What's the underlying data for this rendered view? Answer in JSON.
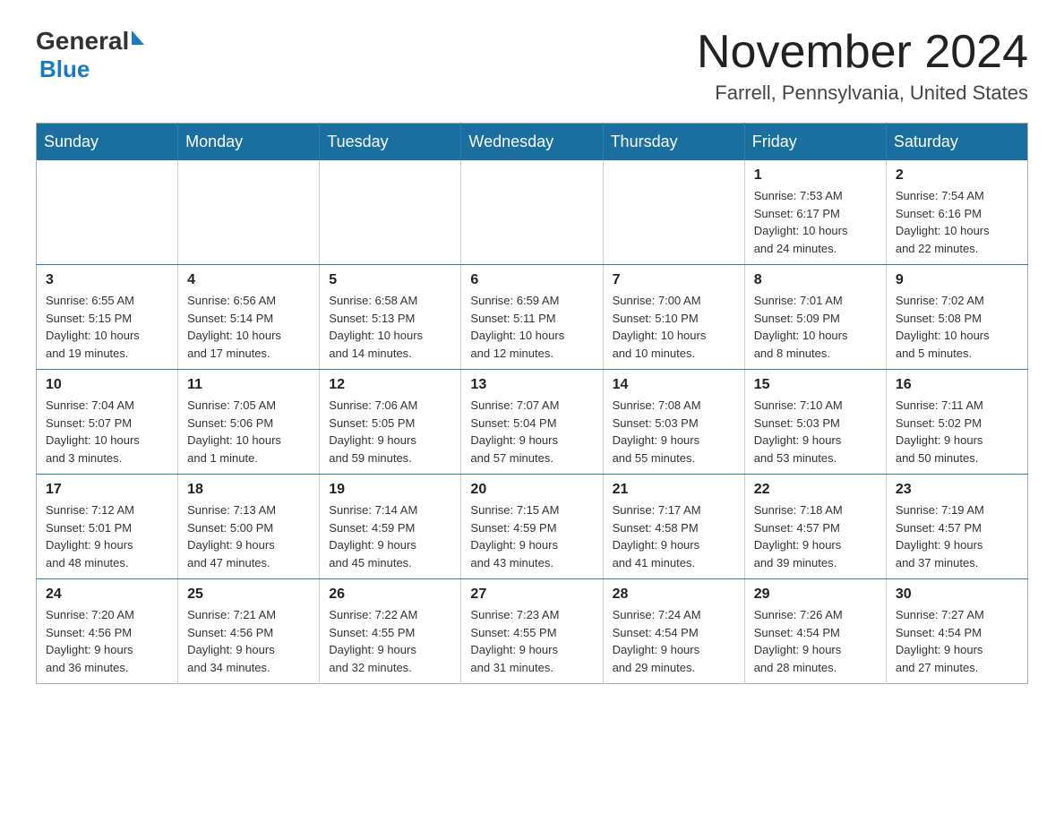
{
  "header": {
    "logo": {
      "general": "General",
      "blue": "Blue"
    },
    "title": "November 2024",
    "location": "Farrell, Pennsylvania, United States"
  },
  "weekdays": [
    "Sunday",
    "Monday",
    "Tuesday",
    "Wednesday",
    "Thursday",
    "Friday",
    "Saturday"
  ],
  "weeks": [
    [
      {
        "day": "",
        "info": ""
      },
      {
        "day": "",
        "info": ""
      },
      {
        "day": "",
        "info": ""
      },
      {
        "day": "",
        "info": ""
      },
      {
        "day": "",
        "info": ""
      },
      {
        "day": "1",
        "info": "Sunrise: 7:53 AM\nSunset: 6:17 PM\nDaylight: 10 hours\nand 24 minutes."
      },
      {
        "day": "2",
        "info": "Sunrise: 7:54 AM\nSunset: 6:16 PM\nDaylight: 10 hours\nand 22 minutes."
      }
    ],
    [
      {
        "day": "3",
        "info": "Sunrise: 6:55 AM\nSunset: 5:15 PM\nDaylight: 10 hours\nand 19 minutes."
      },
      {
        "day": "4",
        "info": "Sunrise: 6:56 AM\nSunset: 5:14 PM\nDaylight: 10 hours\nand 17 minutes."
      },
      {
        "day": "5",
        "info": "Sunrise: 6:58 AM\nSunset: 5:13 PM\nDaylight: 10 hours\nand 14 minutes."
      },
      {
        "day": "6",
        "info": "Sunrise: 6:59 AM\nSunset: 5:11 PM\nDaylight: 10 hours\nand 12 minutes."
      },
      {
        "day": "7",
        "info": "Sunrise: 7:00 AM\nSunset: 5:10 PM\nDaylight: 10 hours\nand 10 minutes."
      },
      {
        "day": "8",
        "info": "Sunrise: 7:01 AM\nSunset: 5:09 PM\nDaylight: 10 hours\nand 8 minutes."
      },
      {
        "day": "9",
        "info": "Sunrise: 7:02 AM\nSunset: 5:08 PM\nDaylight: 10 hours\nand 5 minutes."
      }
    ],
    [
      {
        "day": "10",
        "info": "Sunrise: 7:04 AM\nSunset: 5:07 PM\nDaylight: 10 hours\nand 3 minutes."
      },
      {
        "day": "11",
        "info": "Sunrise: 7:05 AM\nSunset: 5:06 PM\nDaylight: 10 hours\nand 1 minute."
      },
      {
        "day": "12",
        "info": "Sunrise: 7:06 AM\nSunset: 5:05 PM\nDaylight: 9 hours\nand 59 minutes."
      },
      {
        "day": "13",
        "info": "Sunrise: 7:07 AM\nSunset: 5:04 PM\nDaylight: 9 hours\nand 57 minutes."
      },
      {
        "day": "14",
        "info": "Sunrise: 7:08 AM\nSunset: 5:03 PM\nDaylight: 9 hours\nand 55 minutes."
      },
      {
        "day": "15",
        "info": "Sunrise: 7:10 AM\nSunset: 5:03 PM\nDaylight: 9 hours\nand 53 minutes."
      },
      {
        "day": "16",
        "info": "Sunrise: 7:11 AM\nSunset: 5:02 PM\nDaylight: 9 hours\nand 50 minutes."
      }
    ],
    [
      {
        "day": "17",
        "info": "Sunrise: 7:12 AM\nSunset: 5:01 PM\nDaylight: 9 hours\nand 48 minutes."
      },
      {
        "day": "18",
        "info": "Sunrise: 7:13 AM\nSunset: 5:00 PM\nDaylight: 9 hours\nand 47 minutes."
      },
      {
        "day": "19",
        "info": "Sunrise: 7:14 AM\nSunset: 4:59 PM\nDaylight: 9 hours\nand 45 minutes."
      },
      {
        "day": "20",
        "info": "Sunrise: 7:15 AM\nSunset: 4:59 PM\nDaylight: 9 hours\nand 43 minutes."
      },
      {
        "day": "21",
        "info": "Sunrise: 7:17 AM\nSunset: 4:58 PM\nDaylight: 9 hours\nand 41 minutes."
      },
      {
        "day": "22",
        "info": "Sunrise: 7:18 AM\nSunset: 4:57 PM\nDaylight: 9 hours\nand 39 minutes."
      },
      {
        "day": "23",
        "info": "Sunrise: 7:19 AM\nSunset: 4:57 PM\nDaylight: 9 hours\nand 37 minutes."
      }
    ],
    [
      {
        "day": "24",
        "info": "Sunrise: 7:20 AM\nSunset: 4:56 PM\nDaylight: 9 hours\nand 36 minutes."
      },
      {
        "day": "25",
        "info": "Sunrise: 7:21 AM\nSunset: 4:56 PM\nDaylight: 9 hours\nand 34 minutes."
      },
      {
        "day": "26",
        "info": "Sunrise: 7:22 AM\nSunset: 4:55 PM\nDaylight: 9 hours\nand 32 minutes."
      },
      {
        "day": "27",
        "info": "Sunrise: 7:23 AM\nSunset: 4:55 PM\nDaylight: 9 hours\nand 31 minutes."
      },
      {
        "day": "28",
        "info": "Sunrise: 7:24 AM\nSunset: 4:54 PM\nDaylight: 9 hours\nand 29 minutes."
      },
      {
        "day": "29",
        "info": "Sunrise: 7:26 AM\nSunset: 4:54 PM\nDaylight: 9 hours\nand 28 minutes."
      },
      {
        "day": "30",
        "info": "Sunrise: 7:27 AM\nSunset: 4:54 PM\nDaylight: 9 hours\nand 27 minutes."
      }
    ]
  ]
}
